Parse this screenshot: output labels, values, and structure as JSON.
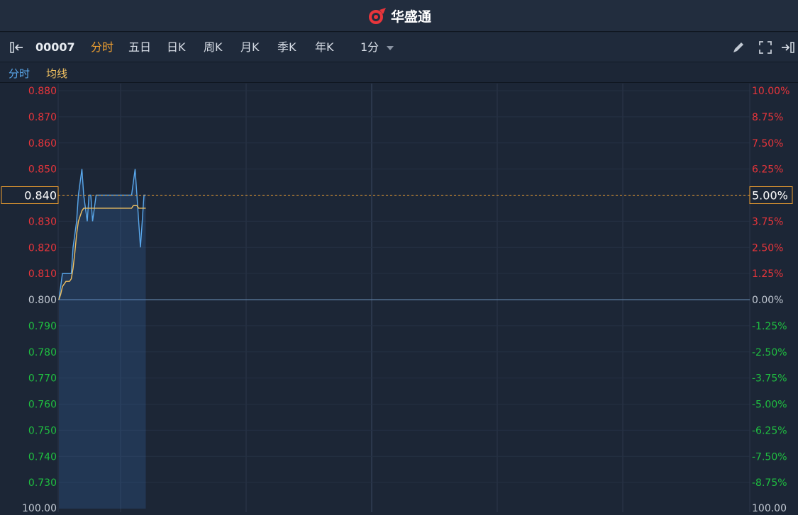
{
  "app": {
    "title": "华盛通"
  },
  "toolbar": {
    "code": "00007",
    "tabs": [
      "分时",
      "五日",
      "日K",
      "周K",
      "月K",
      "季K",
      "年K"
    ],
    "active_tab": "分时",
    "interval": "1分"
  },
  "legend": {
    "line1": "分时",
    "line2": "均线"
  },
  "colors": {
    "up": "#e8353b",
    "down": "#1fbf40",
    "neutral": "#c2c9d3",
    "price_line": "#5aa8ec",
    "avg_line": "#f0c060",
    "accent": "#f0a030"
  },
  "chart_data": {
    "type": "line",
    "title": "",
    "prev_close": 0.8,
    "ylim": [
      0.72,
      0.88
    ],
    "y_ticks_left": [
      "0.880",
      "0.870",
      "0.860",
      "0.850",
      "0.840",
      "0.830",
      "0.820",
      "0.810",
      "0.800",
      "0.790",
      "0.780",
      "0.770",
      "0.760",
      "0.750",
      "0.740",
      "0.730"
    ],
    "y_ticks_right": [
      "10.00%",
      "8.75%",
      "7.50%",
      "6.25%",
      "5.00%",
      "3.75%",
      "2.50%",
      "1.25%",
      "0.00%",
      "-1.25%",
      "-2.50%",
      "-3.75%",
      "-5.00%",
      "-6.25%",
      "-7.50%",
      "-8.75%"
    ],
    "current_price_label": "0.840",
    "current_pct_label": "5.00%",
    "bottom_left_label": "100.00",
    "bottom_right_label": "100.00",
    "series": [
      {
        "name": "分时",
        "values": [
          0.8,
          0.805,
          0.81,
          0.81,
          0.81,
          0.81,
          0.81,
          0.81,
          0.82,
          0.825,
          0.83,
          0.84,
          0.845,
          0.85,
          0.84,
          0.835,
          0.83,
          0.84,
          0.84,
          0.83,
          0.835,
          0.84,
          0.84,
          0.84,
          0.84,
          0.84,
          0.84,
          0.84,
          0.84,
          0.84,
          0.84,
          0.84,
          0.84,
          0.84,
          0.84,
          0.84,
          0.84,
          0.84,
          0.84,
          0.84,
          0.84,
          0.84,
          0.845,
          0.85,
          0.84,
          0.83,
          0.82,
          0.83,
          0.84,
          0.84
        ]
      },
      {
        "name": "均线",
        "values": [
          0.8,
          0.802,
          0.805,
          0.806,
          0.807,
          0.807,
          0.807,
          0.808,
          0.812,
          0.818,
          0.825,
          0.83,
          0.832,
          0.834,
          0.835,
          0.835,
          0.835,
          0.835,
          0.835,
          0.835,
          0.835,
          0.835,
          0.835,
          0.835,
          0.835,
          0.835,
          0.835,
          0.835,
          0.835,
          0.835,
          0.835,
          0.835,
          0.835,
          0.835,
          0.835,
          0.835,
          0.835,
          0.835,
          0.835,
          0.835,
          0.835,
          0.835,
          0.836,
          0.836,
          0.836,
          0.835,
          0.835,
          0.835,
          0.835,
          0.835
        ]
      }
    ],
    "grid": true
  }
}
